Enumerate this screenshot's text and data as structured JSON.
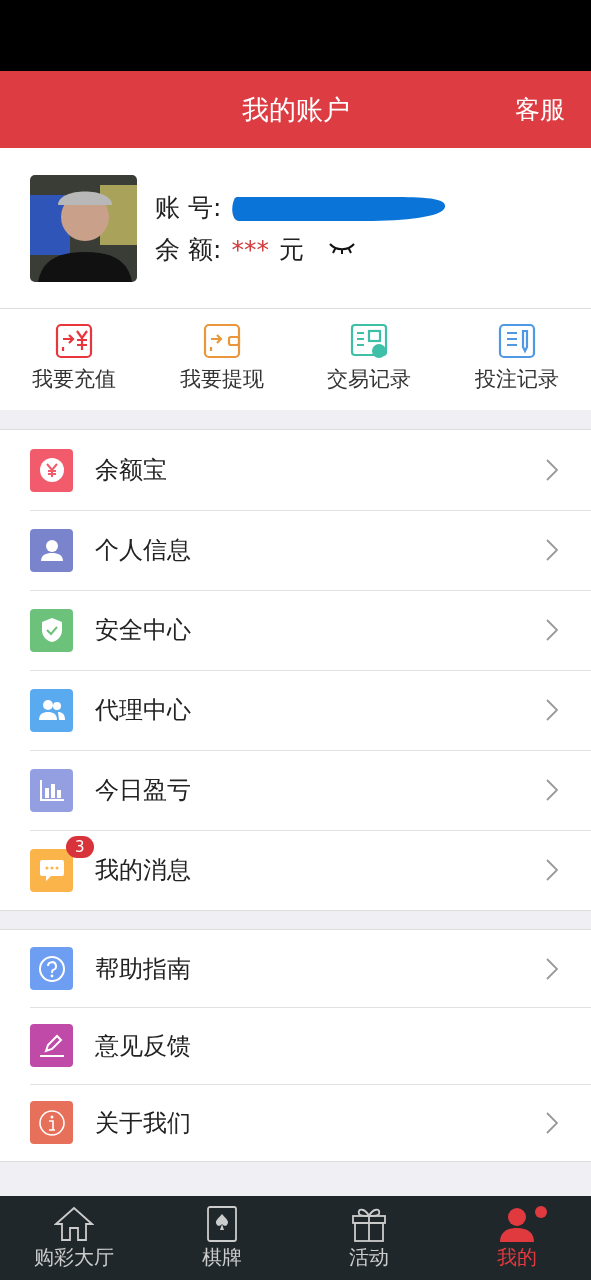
{
  "header": {
    "title": "我的账户",
    "action": "客服"
  },
  "profile": {
    "account_label": "账 号:",
    "account_redacted": true,
    "balance_label": "余 额:",
    "balance": "***",
    "unit": "元",
    "balance_hidden": true
  },
  "actions": [
    {
      "kind": "recharge",
      "label": "我要充值",
      "color": "#e8363c"
    },
    {
      "kind": "withdraw",
      "label": "我要提现",
      "color": "#e9973a"
    },
    {
      "kind": "transactions",
      "label": "交易记录",
      "color": "#3dbfa8"
    },
    {
      "kind": "bets",
      "label": "投注记录",
      "color": "#4f98e3"
    }
  ],
  "menu_groups": [
    [
      {
        "kind": "yen",
        "label": "余额宝",
        "color": "#f15b6c",
        "chevron": true
      },
      {
        "kind": "person",
        "label": "个人信息",
        "color": "#7a84cc",
        "chevron": true
      },
      {
        "kind": "shield",
        "label": "安全中心",
        "color": "#6cc27a",
        "chevron": true
      },
      {
        "kind": "people",
        "label": "代理中心",
        "color": "#5aaaf0",
        "chevron": true
      },
      {
        "kind": "chart",
        "label": "今日盈亏",
        "color": "#939fe0",
        "chevron": true
      },
      {
        "kind": "chat",
        "label": "我的消息",
        "color": "#fbb44a",
        "chevron": true,
        "badge": "3"
      }
    ],
    [
      {
        "kind": "help",
        "label": "帮助指南",
        "color": "#6d9ef2",
        "chevron": true
      },
      {
        "kind": "edit",
        "label": "意见反馈",
        "color": "#c04aa8",
        "chevron": false
      },
      {
        "kind": "info",
        "label": "关于我们",
        "color": "#e6705a",
        "chevron": true
      }
    ]
  ],
  "tabbar": [
    {
      "kind": "home",
      "label": "购彩大厅",
      "selected": false
    },
    {
      "kind": "cards",
      "label": "棋牌",
      "selected": false
    },
    {
      "kind": "gift",
      "label": "活动",
      "selected": false
    },
    {
      "kind": "user",
      "label": "我的",
      "selected": true,
      "dot": true
    }
  ]
}
